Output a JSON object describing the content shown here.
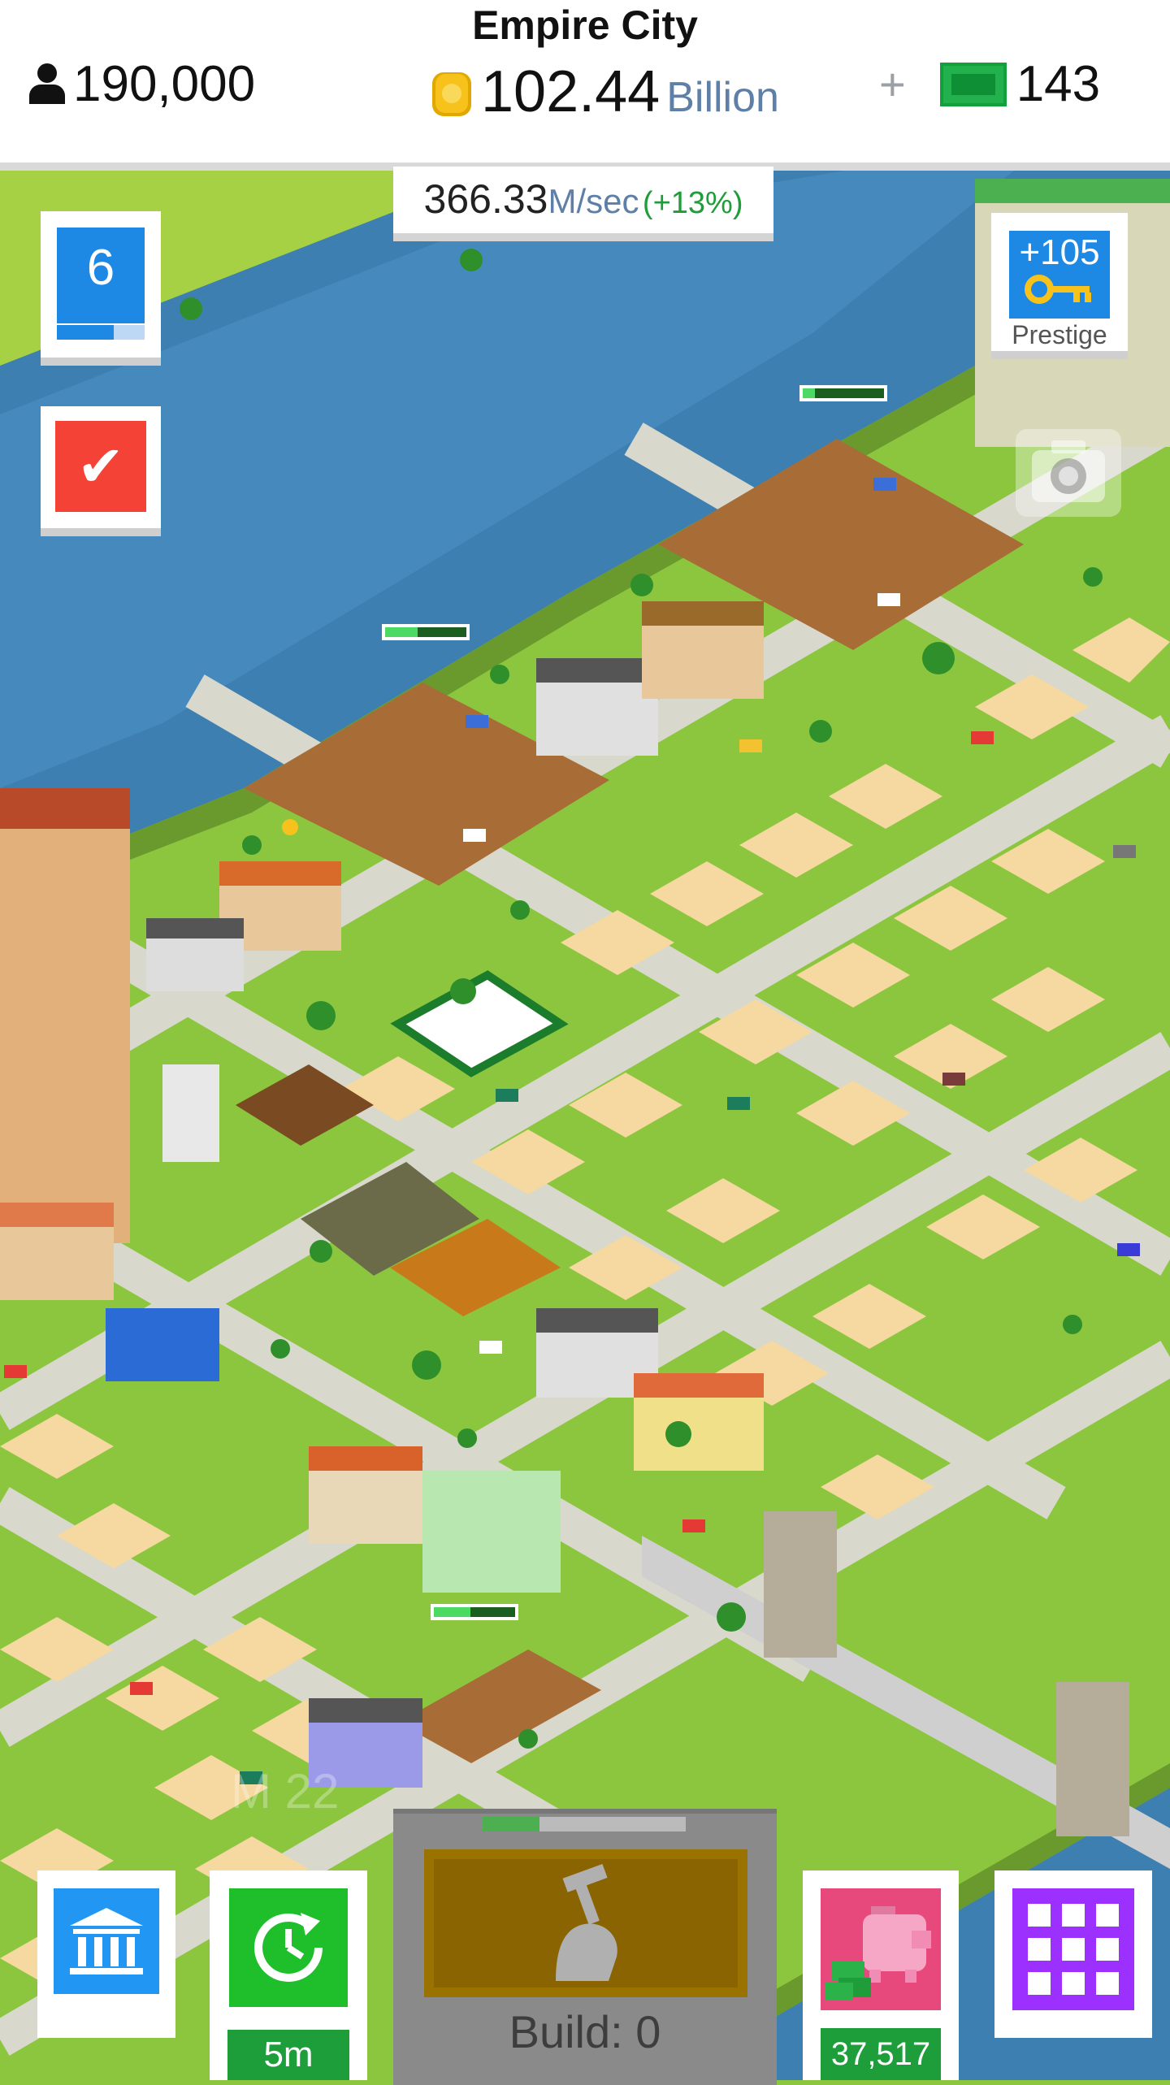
{
  "header": {
    "city_name": "Empire City",
    "population": "190,000",
    "coins_value": "102.44",
    "coins_unit": "Billion",
    "plus_label": "+",
    "cash_value": "143"
  },
  "income": {
    "value": "366.33",
    "unit": "M/sec",
    "percent": "(+13%)"
  },
  "level": {
    "number": "6",
    "progress": 0.65
  },
  "quest_check": "✔",
  "prestige": {
    "value": "+105",
    "label": "Prestige"
  },
  "map_labels": {
    "watermark": "M 22"
  },
  "bottom": {
    "timer_label": "5m",
    "piggy_value": "37,517",
    "build_label": "Build: 0",
    "build_progress": 0.28
  },
  "colors": {
    "grass": "#8cc63f",
    "water": "#3d7fb0",
    "road": "#d9d9cf",
    "dirt": "#a86d36",
    "sand": "#f5d9a0",
    "accent_blue": "#1e88e5",
    "accent_green": "#1fbf2c",
    "accent_purple": "#9b30ff",
    "accent_pink": "#e8497c",
    "accent_red": "#f44336"
  },
  "icons": [
    "person-icon",
    "coin-icon",
    "cash-icon",
    "checkmark-icon",
    "key-icon",
    "camera-icon",
    "bank-icon",
    "clock-refresh-icon",
    "piggy-bank-icon",
    "grid-icon",
    "hammer-hand-icon"
  ]
}
